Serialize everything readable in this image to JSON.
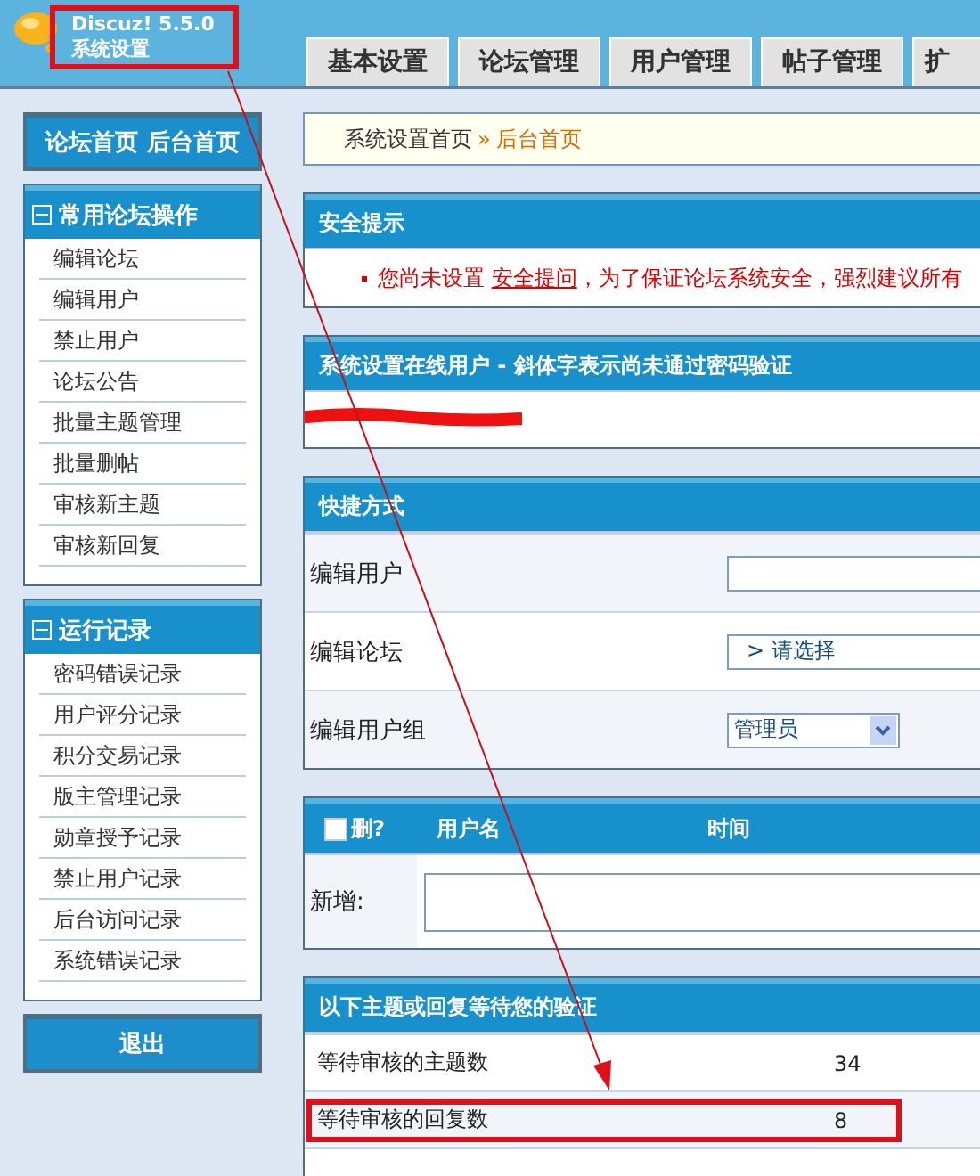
{
  "header": {
    "product": "Discuz! 5.5.0",
    "title": "系统设置",
    "highlighted": true,
    "tabs": [
      {
        "label": "基本设置",
        "selected": false
      },
      {
        "label": "论坛管理",
        "selected": false
      },
      {
        "label": "用户管理",
        "selected": false
      },
      {
        "label": "帖子管理",
        "selected": false
      },
      {
        "label": "扩",
        "selected": false
      }
    ]
  },
  "sidebar": {
    "home_links": "论坛首页 后台首页",
    "groups": [
      {
        "title": "常用论坛操作",
        "expanded": true,
        "items": [
          "编辑论坛",
          "编辑用户",
          "禁止用户",
          "论坛公告",
          "批量主题管理",
          "批量删帖",
          "审核新主题",
          "审核新回复"
        ]
      },
      {
        "title": "运行记录",
        "expanded": true,
        "items": [
          "密码错误记录",
          "用户评分记录",
          "积分交易记录",
          "版主管理记录",
          "勋章授予记录",
          "禁止用户记录",
          "后台访问记录",
          "系统错误记录"
        ]
      }
    ],
    "logout": "退出"
  },
  "breadcrumb": {
    "root": "系统设置首页",
    "separator": "»",
    "current": "后台首页"
  },
  "security_notice": {
    "title": "安全提示",
    "text_before": "您尚未设置",
    "link": "安全提问",
    "text_after": "，为了保证论坛系统安全，强烈建议所有"
  },
  "online_users": {
    "title": "系统设置在线用户 - 斜体字表示尚未通过密码验证",
    "redacted": true
  },
  "shortcuts": {
    "title": "快捷方式",
    "rows": [
      {
        "label": "编辑用户",
        "kind": "input"
      },
      {
        "label": "编辑论坛",
        "kind": "picker",
        "value": "> 请选择"
      },
      {
        "label": "编辑用户组",
        "kind": "select",
        "value": "管理员"
      }
    ]
  },
  "notes_table": {
    "columns": [
      "删?",
      "用户名",
      "时间"
    ],
    "select_all_checked": false,
    "new_label": "新增:"
  },
  "pending": {
    "title": "以下主题或回复等待您的验证",
    "rows": [
      {
        "label": "等待审核的主题数",
        "count": "34",
        "highlighted": false
      },
      {
        "label": "等待审核的回复数",
        "count": "8",
        "highlighted": true
      }
    ]
  },
  "annotation_arrow": true
}
